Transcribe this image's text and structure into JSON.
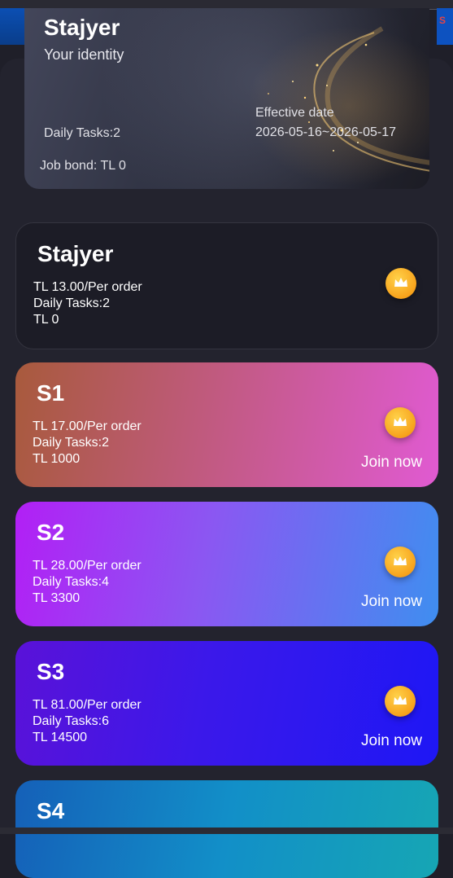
{
  "edge_right_text": "S",
  "identity": {
    "level_name": "Stajyer",
    "subtitle": "Your identity",
    "effective_label": "Effective date",
    "effective_value": "2026-05-16~2026-05-17",
    "daily_tasks": "Daily Tasks:2",
    "job_bond": "Job bond: TL 0"
  },
  "levels": [
    {
      "name": "Stajyer",
      "price": "TL 13.00/Per order",
      "daily": "Daily Tasks:2",
      "bond": "TL 0",
      "join": ""
    },
    {
      "name": "S1",
      "price": "TL 17.00/Per order",
      "daily": "Daily Tasks:2",
      "bond": "TL 1000",
      "join": "Join now"
    },
    {
      "name": "S2",
      "price": "TL 28.00/Per order",
      "daily": "Daily Tasks:4",
      "bond": "TL 3300",
      "join": "Join now"
    },
    {
      "name": "S3",
      "price": "TL 81.00/Per order",
      "daily": "Daily Tasks:6",
      "bond": "TL 14500",
      "join": "Join now"
    },
    {
      "name": "S4",
      "price": "",
      "daily": "",
      "bond": "",
      "join": ""
    }
  ],
  "icons": {
    "level_badge": "crown-icon"
  },
  "colors": {
    "background": "#1f1f29",
    "crown": "#f7a21b"
  }
}
